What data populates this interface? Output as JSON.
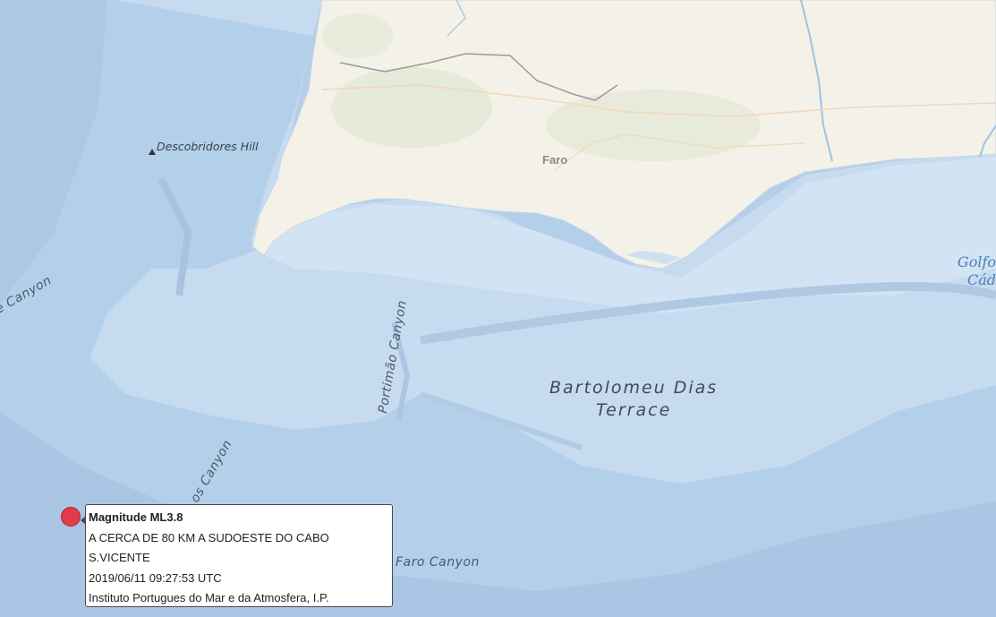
{
  "map_labels": {
    "hill": "Descobridores Hill",
    "canyon_left": "e Canyon",
    "canyon_mid": "Portimão Canyon",
    "canyon_sw": "os Canyon",
    "canyon_faro": "Faro Canyon",
    "terrace_line1": "Bartolomeu Dias",
    "terrace_line2": "Terrace",
    "city": "Faro",
    "golfo_line1": "Golfo",
    "golfo_line2": "Cád"
  },
  "popup": {
    "title": "Magnitude ML3.8",
    "location_line1": "A CERCA DE 80 KM A SUDOESTE DO CABO",
    "location_line2": "S.VICENTE",
    "datetime": "2019/06/11 09:27:53 UTC",
    "source": "Instituto Portugues do Mar e da Atmosfera, I.P."
  },
  "colors": {
    "ocean": "#b9d3ec",
    "shelf": "#cfe0f2",
    "land": "#f4f1e8",
    "marker": "#e03b46"
  }
}
